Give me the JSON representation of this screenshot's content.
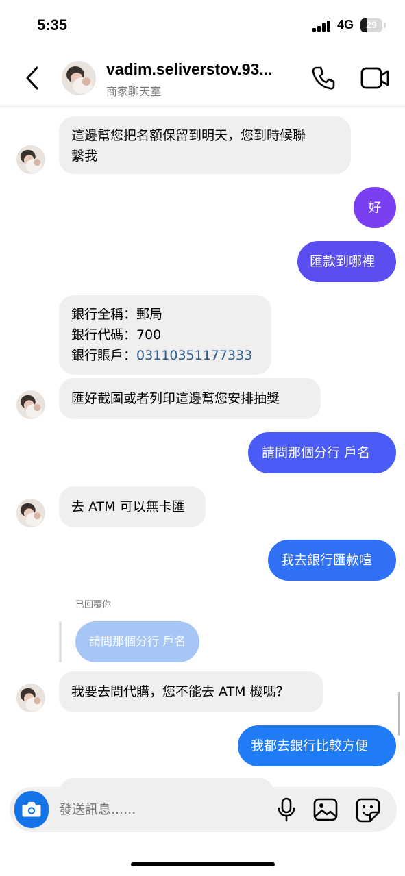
{
  "status_bar": {
    "time": "5:35",
    "network": "4G",
    "battery": "29",
    "battery_level": 0.29
  },
  "header": {
    "title": "vadim.seliverstov.93...",
    "subtitle": "商家聊天室"
  },
  "messages": [
    {
      "from": "them",
      "lines": [
        "這邊幫您把名額保留到明天，您到時候聯",
        "繫我"
      ]
    },
    {
      "from": "me",
      "text": "好"
    },
    {
      "from": "me",
      "text": "匯款到哪裡"
    },
    {
      "from": "them",
      "lines": [
        "銀行全稱：郵局",
        "銀行代碼：700",
        "銀行賬戶："
      ],
      "account": "03110351177333"
    },
    {
      "from": "them",
      "text": "匯好截圖或者列印這邊幫您安排抽獎"
    },
    {
      "from": "me",
      "text": "請問那個分行 戶名"
    },
    {
      "from": "them",
      "text": "去 ATM 可以無卡匯"
    },
    {
      "from": "me",
      "text": "我去銀行匯款噎"
    },
    {
      "from": "them",
      "text": "我要去問代購，您不能去 ATM 機嗎？"
    },
    {
      "from": "me",
      "text": "我都去銀行比較方便"
    }
  ],
  "reply": {
    "label": "已回覆你",
    "quoted": "請問那個分行 戶名"
  },
  "composer": {
    "placeholder": "發送訊息......"
  },
  "colors": {
    "purple": "#7b3ff2",
    "indigo": "#5a4ef0",
    "blue_violet": "#4a5cf5",
    "blue": "#2f70f5",
    "blue2": "#1f7cf5"
  }
}
